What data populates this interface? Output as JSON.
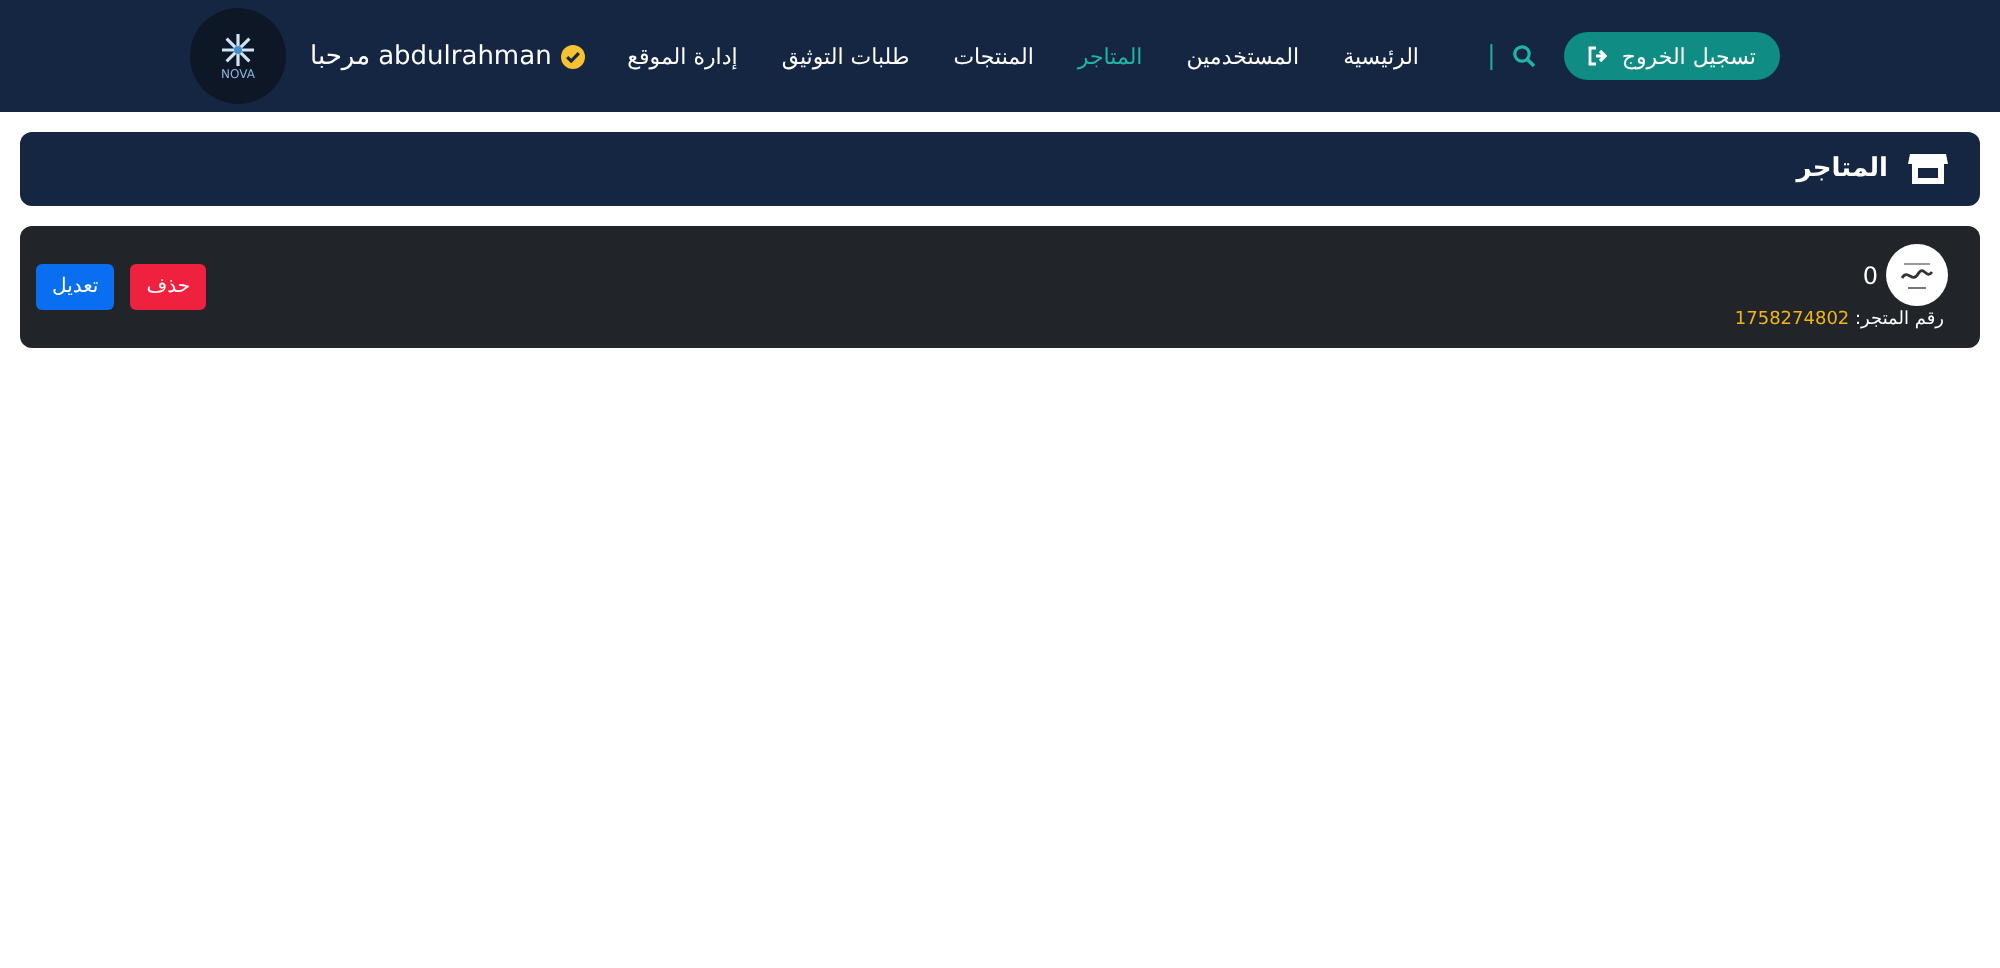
{
  "navbar": {
    "logout_button": "تسجيل الخروج",
    "divider": "|",
    "links": [
      {
        "label": "الرئيسية",
        "selected": false
      },
      {
        "label": "المستخدمين",
        "selected": false
      },
      {
        "label": "المتاجر",
        "selected": true
      },
      {
        "label": "المنتجات",
        "selected": false
      },
      {
        "label": "طلبات التوثيق",
        "selected": false
      },
      {
        "label": "إدارة الموقع",
        "selected": false
      }
    ],
    "user": {
      "name": "abdulrahman",
      "verified": true,
      "greeting": "مرحبا",
      "avatar_text": "NOVA"
    }
  },
  "page_header": {
    "title": "المتاجر"
  },
  "stores": [
    {
      "name": "0",
      "number_label": "رقم المتجر:",
      "number": "1758274802",
      "buttons": [
        {
          "kind": "delete",
          "label": "حذف"
        },
        {
          "kind": "edit",
          "label": "تعديل"
        }
      ]
    }
  ]
}
